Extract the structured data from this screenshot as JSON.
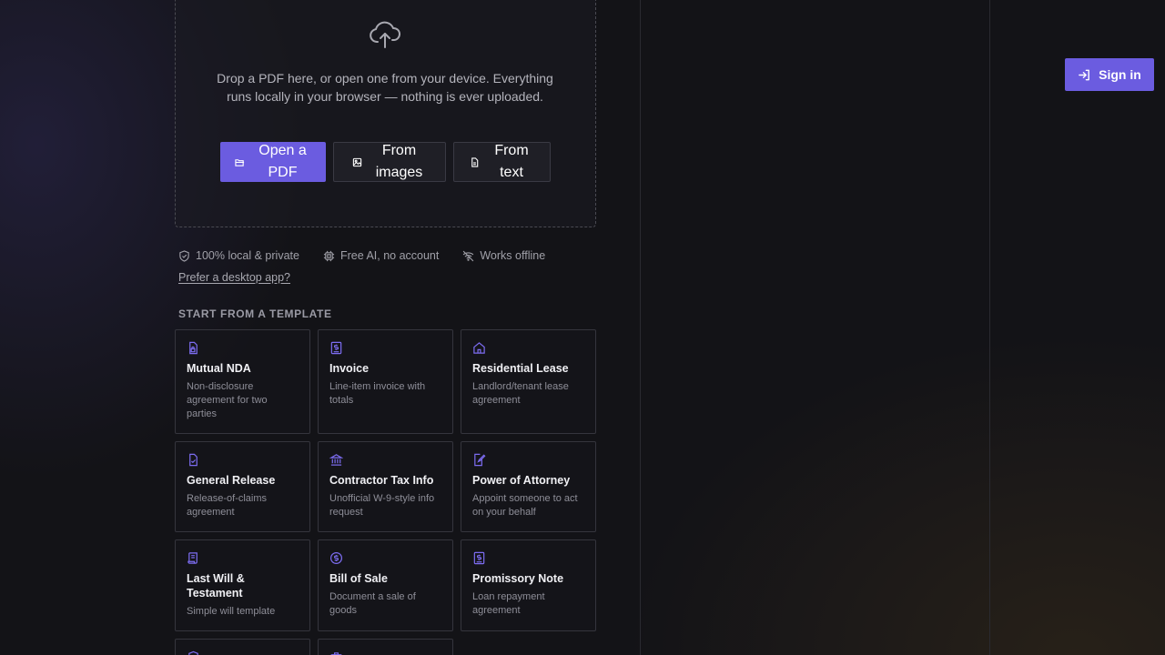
{
  "upload": {
    "description": "Drop a PDF here, or open one from your device. Everything runs locally in your browser — nothing is ever uploaded.",
    "buttons": {
      "open_pdf": "Open a PDF",
      "from_images": "From images",
      "from_text": "From text"
    }
  },
  "features": {
    "local": "100% local & private",
    "free_ai": "Free AI, no account",
    "offline": "Works offline"
  },
  "desktop_link": "Prefer a desktop app?",
  "templates": {
    "heading": "START FROM A TEMPLATE",
    "items": [
      {
        "title": "Mutual NDA",
        "desc": "Non-disclosure agreement for two parties",
        "icon": "document-lock-icon"
      },
      {
        "title": "Invoice",
        "desc": "Line-item invoice with totals",
        "icon": "invoice-icon"
      },
      {
        "title": "Residential Lease",
        "desc": "Landlord/tenant lease agreement",
        "icon": "house-icon"
      },
      {
        "title": "General Release",
        "desc": "Release-of-claims agreement",
        "icon": "document-check-icon"
      },
      {
        "title": "Contractor Tax Info",
        "desc": "Unofficial W-9-style info request",
        "icon": "bank-icon"
      },
      {
        "title": "Power of Attorney",
        "desc": "Appoint someone to act on your behalf",
        "icon": "document-pen-icon"
      },
      {
        "title": "Last Will & Testament",
        "desc": "Simple will template",
        "icon": "scroll-icon"
      },
      {
        "title": "Bill of Sale",
        "desc": "Document a sale of goods",
        "icon": "dollar-coin-icon"
      },
      {
        "title": "Promissory Note",
        "desc": "Loan repayment agreement",
        "icon": "receipt-icon"
      }
    ]
  },
  "auth": {
    "sign_in": "Sign in"
  },
  "colors": {
    "accent": "#6b5ce0",
    "background": "#141418"
  }
}
